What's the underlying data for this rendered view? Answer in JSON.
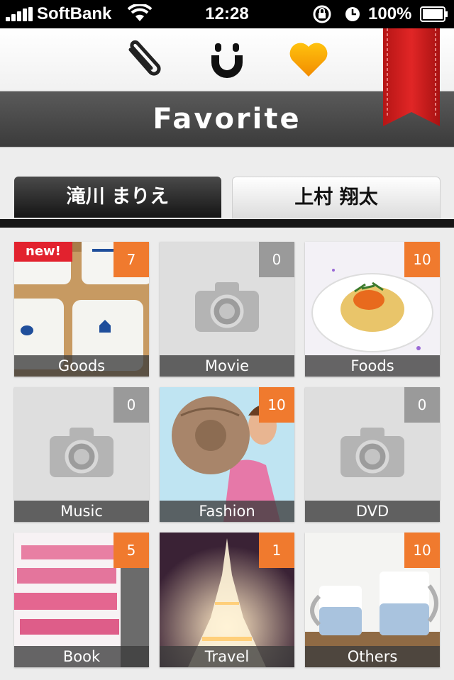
{
  "status_bar": {
    "carrier": "SoftBank",
    "time": "12:28",
    "battery": "100%"
  },
  "toolbar": {
    "icons": [
      "paperclip-icon",
      "smile-icon",
      "heart-icon"
    ],
    "accent": "#d21f1f"
  },
  "header": {
    "title": "Favorite"
  },
  "tabs": [
    {
      "label": "滝川 まりえ",
      "active": true
    },
    {
      "label": "上村 翔太",
      "active": false
    }
  ],
  "tiles": [
    {
      "label": "Goods",
      "count": "7",
      "new_badge": "new!"
    },
    {
      "label": "Movie",
      "count": "0"
    },
    {
      "label": "Foods",
      "count": "10"
    },
    {
      "label": "Music",
      "count": "0"
    },
    {
      "label": "Fashion",
      "count": "10"
    },
    {
      "label": "DVD",
      "count": "0"
    },
    {
      "label": "Book",
      "count": "5"
    },
    {
      "label": "Travel",
      "count": "1"
    },
    {
      "label": "Others",
      "count": "10"
    }
  ],
  "colors": {
    "count_orange": "#f07a2e",
    "count_gray": "#9a9a9a",
    "new_badge": "#e2222e"
  }
}
